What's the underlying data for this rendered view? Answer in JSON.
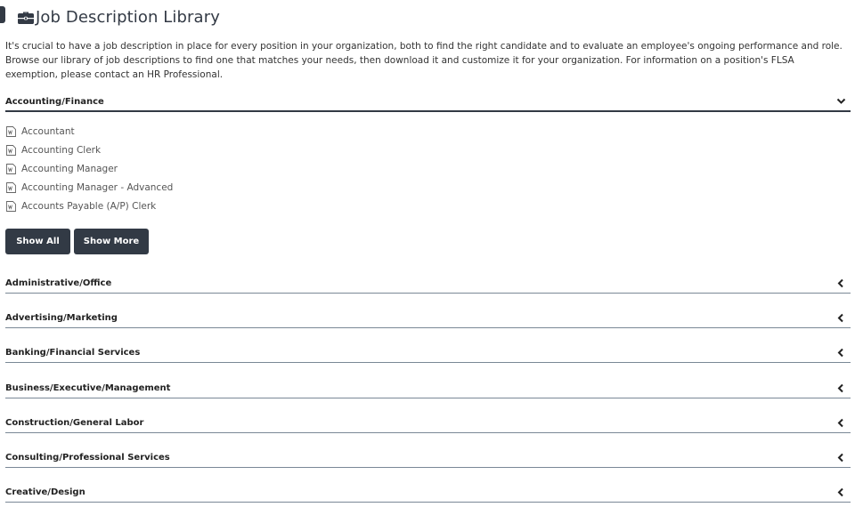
{
  "header": {
    "title": "Job Description Library",
    "icon": "briefcase-icon"
  },
  "intro": {
    "text": "It's crucial to have a job description in place for every position in your organization, both to find the right candidate and to evaluate an employee's ongoing performance and role. Browse our library of job descriptions to find one that matches your needs, then download it and customize it for your organization. For information on a position's FLSA exemption, please contact an HR Professional."
  },
  "open_section": {
    "title": "Accounting/Finance",
    "icon": "chevron-down-icon",
    "items": [
      {
        "label": "Accountant",
        "icon": "word-doc-icon"
      },
      {
        "label": "Accounting Clerk",
        "icon": "word-doc-icon"
      },
      {
        "label": "Accounting Manager",
        "icon": "word-doc-icon"
      },
      {
        "label": "Accounting Manager - Advanced",
        "icon": "word-doc-icon"
      },
      {
        "label": "Accounts Payable (A/P) Clerk",
        "icon": "word-doc-icon"
      }
    ],
    "show_all_label": "Show All",
    "show_more_label": "Show More"
  },
  "sections": [
    {
      "title": "Administrative/Office",
      "icon": "chevron-left-icon"
    },
    {
      "title": "Advertising/Marketing",
      "icon": "chevron-left-icon"
    },
    {
      "title": "Banking/Financial Services",
      "icon": "chevron-left-icon"
    },
    {
      "title": "Business/Executive/Management",
      "icon": "chevron-left-icon"
    },
    {
      "title": "Construction/General Labor",
      "icon": "chevron-left-icon"
    },
    {
      "title": "Consulting/Professional Services",
      "icon": "chevron-left-icon"
    },
    {
      "title": "Creative/Design",
      "icon": "chevron-left-icon"
    }
  ],
  "colors": {
    "dark": "#323a45",
    "text": "#333333",
    "muted": "#555555",
    "divider": "#7a8896"
  }
}
